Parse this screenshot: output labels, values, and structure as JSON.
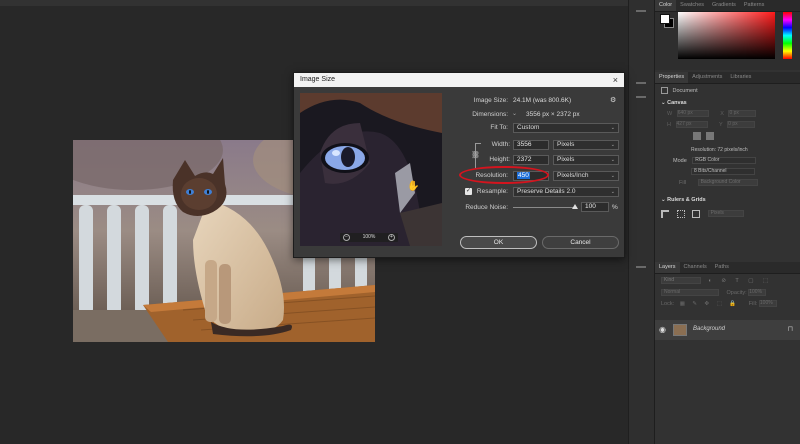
{
  "workspace": {
    "bg_color": "#282828"
  },
  "dialog": {
    "title": "Image Size",
    "close_glyph": "×",
    "image_size_label": "Image Size:",
    "image_size_value": "24.1M (was 800.6K)",
    "dimensions_label": "Dimensions:",
    "dimensions_value": "3556 px  ×  2372 px",
    "fit_to_label": "Fit To:",
    "fit_to_value": "Custom",
    "width_label": "Width:",
    "width_value": "3556",
    "width_unit": "Pixels",
    "height_label": "Height:",
    "height_value": "2372",
    "height_unit": "Pixels",
    "resolution_label": "Resolution:",
    "resolution_value": "450",
    "resolution_unit": "Pixels/Inch",
    "resample_label": "Resample:",
    "resample_checked": true,
    "resample_value": "Preserve Details 2.0",
    "reduce_noise_label": "Reduce Noise:",
    "reduce_noise_value": "100",
    "reduce_noise_unit": "%",
    "reduce_noise_level": 1.0,
    "ok_label": "OK",
    "cancel_label": "Cancel",
    "preview_zoom": "100%",
    "highlight_color": "#d4141e"
  },
  "panels": {
    "color_tabs": [
      "Color",
      "Swatches",
      "Gradients",
      "Patterns"
    ],
    "properties_tabs": [
      "Properties",
      "Adjustments",
      "Libraries"
    ],
    "document_label": "Document",
    "canvas_label": "Canvas",
    "w_label": "W",
    "w_value": "640 px",
    "h_label": "H",
    "h_value": "427 px",
    "x_label": "X",
    "x_value": "0 px",
    "y_label": "Y",
    "y_value": "0 px",
    "resolution_text": "Resolution: 72 pixels/inch",
    "mode_label": "Mode",
    "mode_value": "RGB Color",
    "bitdepth_value": "8 Bits/Channel",
    "fill_label": "Fill",
    "fill_value": "Background Color",
    "rulers_label": "Rulers & Grids",
    "rulers_unit": "Pixels",
    "layers_tabs": [
      "Layers",
      "Channels",
      "Paths"
    ],
    "layer_kind": "Kind",
    "blend_mode": "Normal",
    "opacity_label": "Opacity:",
    "opacity_value": "100%",
    "lock_label": "Lock:",
    "fill2_label": "Fill:",
    "fill2_value": "100%",
    "layer_name": "Background"
  }
}
